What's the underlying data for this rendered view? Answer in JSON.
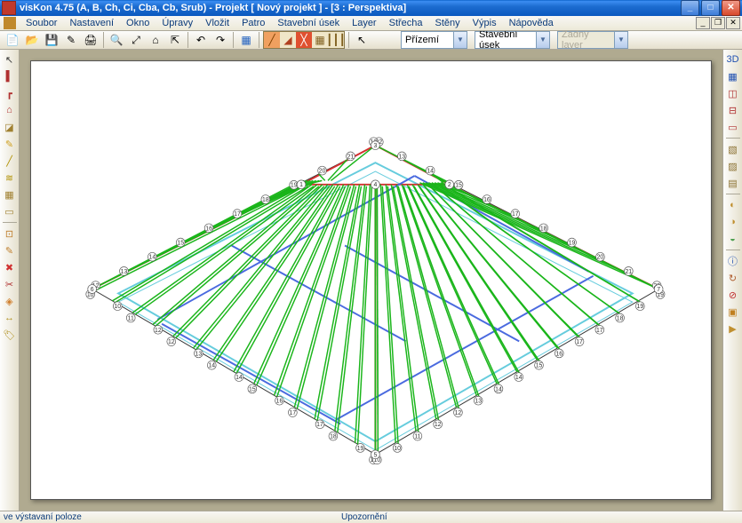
{
  "title": "visKon 4.75 (A, B, Ch, Ci, Cba, Cb, Srub) - Projekt [ Nový projekt ]  - [3 : Perspektiva]",
  "menu": [
    "Soubor",
    "Nastavení",
    "Okno",
    "Úpravy",
    "Vložit",
    "Patro",
    "Stavební úsek",
    "Layer",
    "Střecha",
    "Stěny",
    "Výpis",
    "Nápověda"
  ],
  "combos": {
    "floor": "Přízemí",
    "section": "Stavební úsek",
    "layer": "Žádný layer"
  },
  "status": {
    "left": "ve výstavaní poloze",
    "mid": "Upozornění"
  },
  "colors": {
    "accent": "#0a5fc7",
    "rafter_green": "#1ab51a",
    "ridge_red": "#d63030",
    "beam_blue": "#4a6adf",
    "plate_cyan": "#66ccdd"
  },
  "win_controls": {
    "min": "_",
    "max": "□",
    "close": "✕"
  },
  "mdi_controls": {
    "min": "_",
    "restore": "❐",
    "close": "✕"
  },
  "toolbar_icons": [
    "📄",
    "📂",
    "💾",
    "✎",
    "🖨",
    "🔍",
    "⤢",
    "⌂",
    "⇱",
    "↶",
    "↷",
    "▦",
    "◧",
    "◨"
  ],
  "mode_icons": [
    "╱",
    "◢",
    "╳",
    "▦",
    "┃┃┃"
  ],
  "cursor_icon": "↖",
  "left_tools": [
    {
      "name": "cursor-icon",
      "g": "↖",
      "c": "#333"
    },
    {
      "name": "wall-icon",
      "g": "▌",
      "c": "#b03030"
    },
    {
      "name": "profile-icon",
      "g": "┏",
      "c": "#b03030"
    },
    {
      "name": "house-icon",
      "g": "⌂",
      "c": "#b03030"
    },
    {
      "name": "dormer-icon",
      "g": "◪",
      "c": "#a08030"
    },
    {
      "name": "edit-icon",
      "g": "✎",
      "c": "#d0a020"
    },
    {
      "name": "line-icon",
      "g": "╱",
      "c": "#b09000"
    },
    {
      "name": "align-icon",
      "g": "≋",
      "c": "#b09000"
    },
    {
      "name": "grid-icon",
      "g": "▦",
      "c": "#a08030"
    },
    {
      "name": "plank-icon",
      "g": "▭",
      "c": "#a08030"
    },
    {
      "name": "spacer",
      "g": "",
      "c": ""
    },
    {
      "name": "clip-icon",
      "g": "⊡",
      "c": "#c08030"
    },
    {
      "name": "note-icon",
      "g": "✎",
      "c": "#c08030"
    },
    {
      "name": "delete-icon",
      "g": "✖",
      "c": "#d03030"
    },
    {
      "name": "cut-icon",
      "g": "✂",
      "c": "#b03030"
    },
    {
      "name": "tag-icon",
      "g": "◈",
      "c": "#d08030"
    },
    {
      "name": "measure-icon",
      "g": "↔",
      "c": "#b09020"
    },
    {
      "name": "label-icon",
      "g": "🏷",
      "c": "#b09020"
    }
  ],
  "right_tools": [
    {
      "name": "view3d-icon",
      "g": "3D",
      "c": "#2050b0"
    },
    {
      "name": "grid2d-icon",
      "g": "▦",
      "c": "#2050b0"
    },
    {
      "name": "section-icon",
      "g": "◫",
      "c": "#b03030"
    },
    {
      "name": "elevation-icon",
      "g": "⊟",
      "c": "#b03030"
    },
    {
      "name": "plan-icon",
      "g": "▭",
      "c": "#b03030"
    },
    {
      "name": "spacer",
      "g": "",
      "c": ""
    },
    {
      "name": "layer1-icon",
      "g": "▧",
      "c": "#8a7030"
    },
    {
      "name": "layer2-icon",
      "g": "▨",
      "c": "#8a7030"
    },
    {
      "name": "layer3-icon",
      "g": "▤",
      "c": "#8a7030"
    },
    {
      "name": "spacer",
      "g": "",
      "c": ""
    },
    {
      "name": "shade1-icon",
      "g": "◐",
      "c": "#c09030"
    },
    {
      "name": "shade2-icon",
      "g": "◑",
      "c": "#c09030"
    },
    {
      "name": "shade3-icon",
      "g": "◒",
      "c": "#50a050"
    },
    {
      "name": "spacer",
      "g": "",
      "c": ""
    },
    {
      "name": "info-icon",
      "g": "ⓘ",
      "c": "#2050b0"
    },
    {
      "name": "refresh-icon",
      "g": "↻",
      "c": "#b06030"
    },
    {
      "name": "stop-icon",
      "g": "⊘",
      "c": "#c03030"
    },
    {
      "name": "highlight-icon",
      "g": "▣",
      "c": "#c08020"
    },
    {
      "name": "play-icon",
      "g": "▶",
      "c": "#c09030"
    }
  ]
}
